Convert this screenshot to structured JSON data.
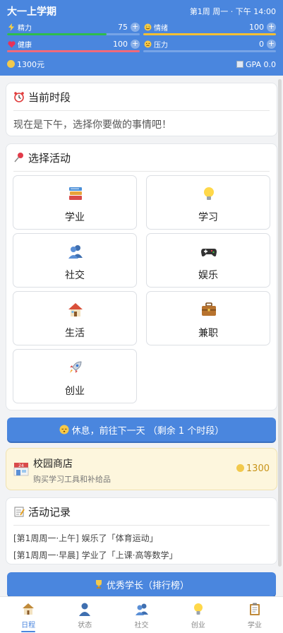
{
  "header": {
    "title": "大一上学期",
    "time": "第1周 周一 · 下午 14:00",
    "stats": [
      {
        "name": "精力",
        "value": "75",
        "icon": "lightning-icon",
        "level": 0.75,
        "color": "#2ebd4a"
      },
      {
        "name": "情绪",
        "value": "100",
        "icon": "smile-icon",
        "level": 1.0,
        "color": "#f5c033"
      },
      {
        "name": "健康",
        "value": "100",
        "icon": "heart-icon",
        "level": 1.0,
        "color": "#f06a7a"
      },
      {
        "name": "压力",
        "value": "0",
        "icon": "worried-icon",
        "level": 0.0,
        "color": "#8aa"
      }
    ],
    "money": "1300元",
    "gpa": "GPA 0.0"
  },
  "period_card": {
    "title": "当前时段",
    "text": "现在是下午，选择你要做的事情吧！"
  },
  "activity_card": {
    "title": "选择活动",
    "items": [
      {
        "label": "学业",
        "icon": "books-icon"
      },
      {
        "label": "学习",
        "icon": "lightbulb-icon"
      },
      {
        "label": "社交",
        "icon": "people-icon"
      },
      {
        "label": "娱乐",
        "icon": "gamepad-icon"
      },
      {
        "label": "生活",
        "icon": "house-icon"
      },
      {
        "label": "兼职",
        "icon": "briefcase-icon"
      },
      {
        "label": "创业",
        "icon": "rocket-icon"
      }
    ]
  },
  "rest_button": "休息，前往下一天 （剩余 1 个时段）",
  "shop": {
    "title": "校园商店",
    "subtitle": "购买学习工具和补给品",
    "price": "1300",
    "icon_text": "24"
  },
  "log_card": {
    "title": "活动记录",
    "entries": [
      "[第1周周一·上午] 娱乐了「体育运动」",
      "[第1周周一·早晨] 学业了「上课·高等数学」"
    ]
  },
  "leaderboard_button": "优秀学长（排行榜）",
  "tabs": [
    {
      "label": "日程",
      "icon": "schedule-icon",
      "active": true
    },
    {
      "label": "状态",
      "icon": "person-icon",
      "active": false
    },
    {
      "label": "社交",
      "icon": "people-icon",
      "active": false
    },
    {
      "label": "创业",
      "icon": "lightbulb-icon",
      "active": false
    },
    {
      "label": "学业",
      "icon": "clipboard-icon",
      "active": false
    }
  ]
}
